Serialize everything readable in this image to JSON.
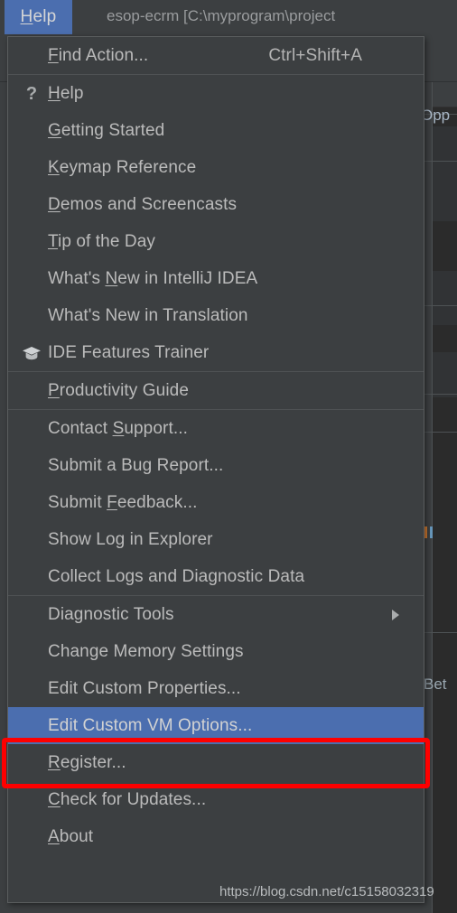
{
  "window": {
    "title": "esop-ecrm [C:\\myprogram\\project",
    "background_fragments": {
      "opp": "Opp",
      "bet": "Bet"
    }
  },
  "menubar": {
    "active_item": {
      "label": "Help",
      "mnemonic": "H",
      "mnemonic_prefix": "",
      "mnemonic_suffix": "elp"
    }
  },
  "menu": {
    "name": "help-menu",
    "groups": [
      {
        "items": [
          {
            "id": "find-action",
            "icon": "",
            "prefix": "",
            "mnemonic": "F",
            "suffix": "ind Action...",
            "shortcut": "Ctrl+Shift+A",
            "arrow": "",
            "selected": false
          }
        ]
      },
      {
        "items": [
          {
            "id": "help",
            "icon": "question-mark-icon",
            "prefix": "",
            "mnemonic": "H",
            "suffix": "elp",
            "shortcut": "",
            "arrow": "",
            "selected": false
          },
          {
            "id": "getting-started",
            "icon": "",
            "prefix": "",
            "mnemonic": "G",
            "suffix": "etting Started",
            "shortcut": "",
            "arrow": "",
            "selected": false
          },
          {
            "id": "keymap-reference",
            "icon": "",
            "prefix": "",
            "mnemonic": "K",
            "suffix": "eymap Reference",
            "shortcut": "",
            "arrow": "",
            "selected": false
          },
          {
            "id": "demos-and-screencasts",
            "icon": "",
            "prefix": "",
            "mnemonic": "D",
            "suffix": "emos and Screencasts",
            "shortcut": "",
            "arrow": "",
            "selected": false
          },
          {
            "id": "tip-of-the-day",
            "icon": "",
            "prefix": "",
            "mnemonic": "T",
            "suffix": "ip of the Day",
            "shortcut": "",
            "arrow": "",
            "selected": false
          },
          {
            "id": "whats-new-in-intellij-idea",
            "icon": "",
            "prefix": "What's ",
            "mnemonic": "N",
            "suffix": "ew in IntelliJ IDEA",
            "shortcut": "",
            "arrow": "",
            "selected": false
          },
          {
            "id": "whats-new-in-translation",
            "icon": "",
            "prefix": "What's New in Translation",
            "mnemonic": "",
            "suffix": "",
            "shortcut": "",
            "arrow": "",
            "selected": false
          },
          {
            "id": "ide-features-trainer",
            "icon": "graduation-cap-icon",
            "prefix": "IDE Features Trainer",
            "mnemonic": "",
            "suffix": "",
            "shortcut": "",
            "arrow": "",
            "selected": false
          }
        ]
      },
      {
        "items": [
          {
            "id": "productivity-guide",
            "icon": "",
            "prefix": "",
            "mnemonic": "P",
            "suffix": "roductivity Guide",
            "shortcut": "",
            "arrow": "",
            "selected": false
          }
        ]
      },
      {
        "items": [
          {
            "id": "contact-support",
            "icon": "",
            "prefix": "Contact ",
            "mnemonic": "S",
            "suffix": "upport...",
            "shortcut": "",
            "arrow": "",
            "selected": false
          },
          {
            "id": "submit-a-bug-report",
            "icon": "",
            "prefix": "Submit a Bug Report...",
            "mnemonic": "",
            "suffix": "",
            "shortcut": "",
            "arrow": "",
            "selected": false
          },
          {
            "id": "submit-feedback",
            "icon": "",
            "prefix": "Submit ",
            "mnemonic": "F",
            "suffix": "eedback...",
            "shortcut": "",
            "arrow": "",
            "selected": false
          },
          {
            "id": "show-log-in-explorer",
            "icon": "",
            "prefix": "Show Log in Explorer",
            "mnemonic": "",
            "suffix": "",
            "shortcut": "",
            "arrow": "",
            "selected": false
          },
          {
            "id": "collect-logs-and-diagnostic-data",
            "icon": "",
            "prefix": "Collect Logs and Diagnostic Data",
            "mnemonic": "",
            "suffix": "",
            "shortcut": "",
            "arrow": "",
            "selected": false
          }
        ]
      },
      {
        "items": [
          {
            "id": "diagnostic-tools",
            "icon": "",
            "prefix": "Diagnostic Tools",
            "mnemonic": "",
            "suffix": "",
            "shortcut": "",
            "arrow": "submenu-arrow-icon",
            "selected": false
          },
          {
            "id": "change-memory-settings",
            "icon": "",
            "prefix": "Change Memory Settings",
            "mnemonic": "",
            "suffix": "",
            "shortcut": "",
            "arrow": "",
            "selected": false
          },
          {
            "id": "edit-custom-properties",
            "icon": "",
            "prefix": "Edit Custom Properties...",
            "mnemonic": "",
            "suffix": "",
            "shortcut": "",
            "arrow": "",
            "selected": false
          },
          {
            "id": "edit-custom-vm-options",
            "icon": "",
            "prefix": "Edit Custom VM Options...",
            "mnemonic": "",
            "suffix": "",
            "shortcut": "",
            "arrow": "",
            "selected": true
          },
          {
            "id": "register",
            "icon": "",
            "prefix": "",
            "mnemonic": "R",
            "suffix": "egister...",
            "shortcut": "",
            "arrow": "",
            "selected": false
          },
          {
            "id": "check-for-updates",
            "icon": "",
            "prefix": "",
            "mnemonic": "C",
            "suffix": "heck for Updates...",
            "shortcut": "",
            "arrow": "",
            "selected": false
          },
          {
            "id": "about",
            "icon": "",
            "prefix": "",
            "mnemonic": "A",
            "suffix": "bout",
            "shortcut": "",
            "arrow": "",
            "selected": false
          }
        ]
      }
    ]
  },
  "annotation": {
    "highlight_color": "#fe0000",
    "target_item": "Edit Custom VM Options..."
  },
  "watermark": {
    "text": "https://blog.csdn.net/c15158032319"
  },
  "colors": {
    "menu_background": "#3c3f41",
    "selection_blue": "#4b6eaf",
    "text": "#bbbbbb",
    "separator": "#4f5254",
    "editor_background": "#2b2b2b"
  }
}
